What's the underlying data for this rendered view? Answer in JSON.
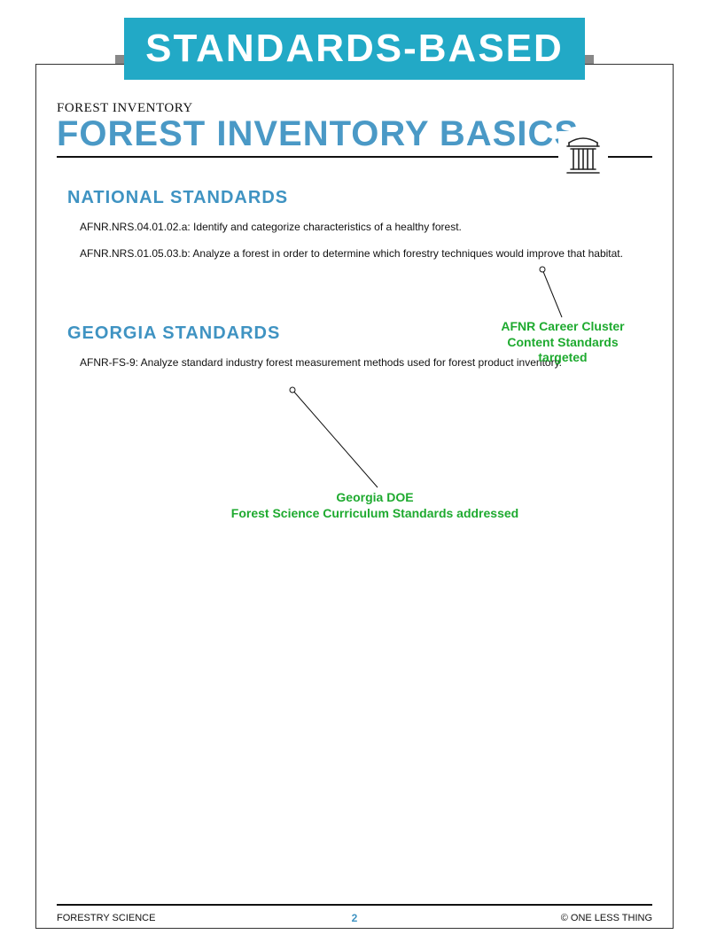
{
  "banner": "STANDARDS-BASED",
  "eyebrow": "FOREST INVENTORY",
  "title": "FOREST INVENTORY BASICS",
  "sections": {
    "national": {
      "heading": "NATIONAL STANDARDS",
      "items": [
        "AFNR.NRS.04.01.02.a: Identify and categorize characteristics of a healthy forest.",
        "AFNR.NRS.01.05.03.b: Analyze a forest in order to determine which forestry techniques would improve that habitat."
      ]
    },
    "georgia": {
      "heading": "GEORGIA STANDARDS",
      "items": [
        "AFNR-FS-9: Analyze standard industry forest measurement methods used for forest product inventory."
      ]
    }
  },
  "annotations": {
    "a1_line1": "AFNR Career Cluster",
    "a1_line2": "Content Standards",
    "a1_line3": "targeted",
    "a2_line1": "Georgia DOE",
    "a2_line2": "Forest Science Curriculum Standards addressed"
  },
  "footer": {
    "left": "FORESTRY SCIENCE",
    "center": "2",
    "right": "© ONE LESS THING"
  }
}
